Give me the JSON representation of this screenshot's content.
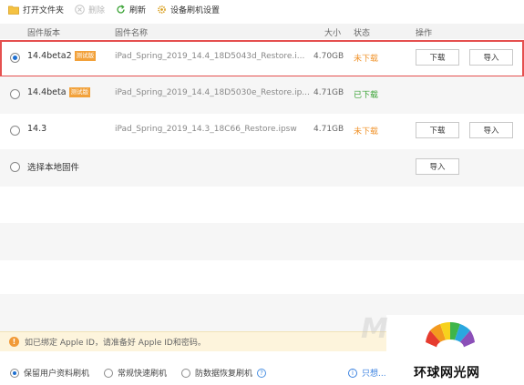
{
  "toolbar": {
    "open_folder": "打开文件夹",
    "delete": "删除",
    "refresh": "刷新",
    "settings": "设备刷机设置"
  },
  "table": {
    "headers": {
      "version": "固件版本",
      "name": "固件名称",
      "size": "大小",
      "status": "状态",
      "action": "操作"
    },
    "rows": [
      {
        "version": "14.4beta2",
        "tag": "测试版",
        "name": "iPad_Spring_2019_14.4_18D5043d_Restore.i...",
        "size": "4.70GB",
        "status": "未下载",
        "status_color": "#f0932b",
        "download": "下载",
        "import": "导入",
        "selected": true
      },
      {
        "version": "14.4beta",
        "tag": "测试版",
        "name": "iPad_Spring_2019_14.4_18D5030e_Restore.ip...",
        "size": "4.71GB",
        "status": "已下载",
        "status_color": "#3aa335",
        "selected": false
      },
      {
        "version": "14.3",
        "tag": "",
        "name": "iPad_Spring_2019_14.3_18C66_Restore.ipsw",
        "size": "4.71GB",
        "status": "未下载",
        "status_color": "#f0932b",
        "download": "下载",
        "import": "导入",
        "selected": false
      }
    ],
    "local": {
      "label": "选择本地固件",
      "import": "导入"
    }
  },
  "notice": {
    "text": "如已绑定 Apple ID，请准备好 Apple ID和密码。"
  },
  "footer": {
    "options": [
      "保留用户资料刷机",
      "常规快速刷机",
      "防数据恢复刷机"
    ],
    "selected_index": 0,
    "link": "只想..."
  },
  "watermark": {
    "text": "环球网光网",
    "letter": "M"
  },
  "colors": {
    "accent": "#1e6fd0",
    "selection_border": "#e5504f",
    "tag_bg": "#f2a13a",
    "notice_bg": "#fdf4dc"
  }
}
